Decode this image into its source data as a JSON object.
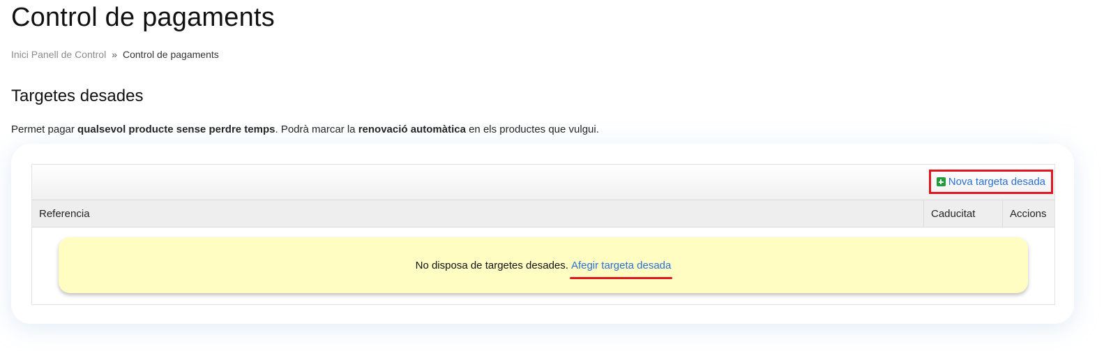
{
  "page": {
    "title": "Control de pagaments"
  },
  "breadcrumb": {
    "home": "Inici",
    "panel": "Panell de Control",
    "separator": "»",
    "current": "Control de pagaments"
  },
  "section": {
    "title": "Targetes desades",
    "intro": {
      "part1": "Permet pagar ",
      "bold1": "qualsevol producte sense perdre temps",
      "part2": ". Podrà marcar la ",
      "bold2": "renovació automàtica",
      "part3": " en els productes que vulgui."
    }
  },
  "toolbar": {
    "new_card_label": "Nova targeta desada",
    "new_card_icon": "plus-square-icon",
    "highlight_color": "#e0161e"
  },
  "table": {
    "columns": [
      "Referencia",
      "Caducitat",
      "Accions"
    ],
    "rows": []
  },
  "empty_state": {
    "message": "No disposa de targetes desades.",
    "link": "Afegir targeta desada",
    "background": "#fffdc2"
  },
  "colors": {
    "link": "#2b6fd6",
    "accent_green": "#1f9d38"
  }
}
